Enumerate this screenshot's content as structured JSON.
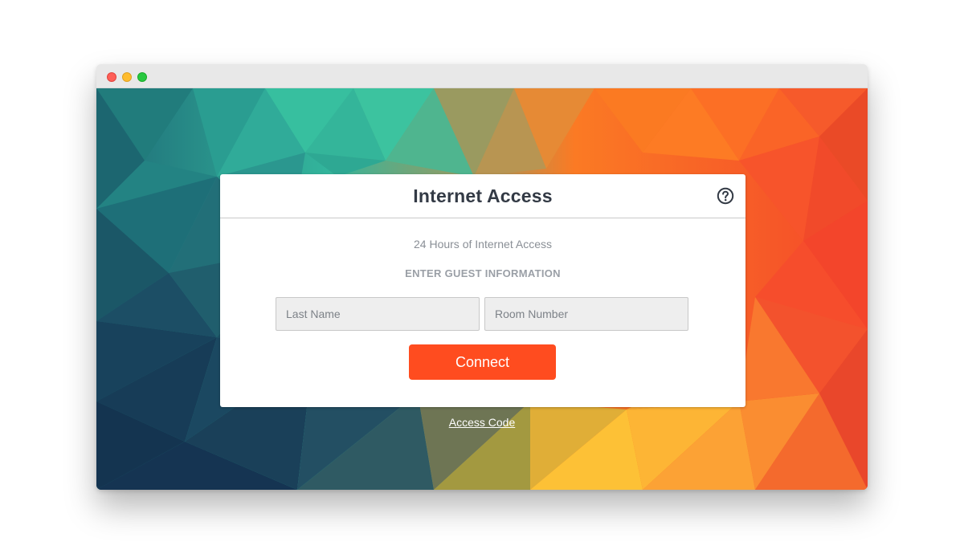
{
  "portal": {
    "title": "Internet Access",
    "subtitle": "24 Hours of Internet Access",
    "section_label": "ENTER GUEST INFORMATION",
    "help_icon": "question-circle-icon"
  },
  "form": {
    "last_name": {
      "value": "",
      "placeholder": "Last Name"
    },
    "room_number": {
      "value": "",
      "placeholder": "Room Number"
    },
    "connect_label": "Connect"
  },
  "footer": {
    "access_code_link": "Access Code"
  },
  "colors": {
    "accent": "#ff4c1f",
    "title_text": "#333a45",
    "muted_text": "#8a8f96"
  }
}
